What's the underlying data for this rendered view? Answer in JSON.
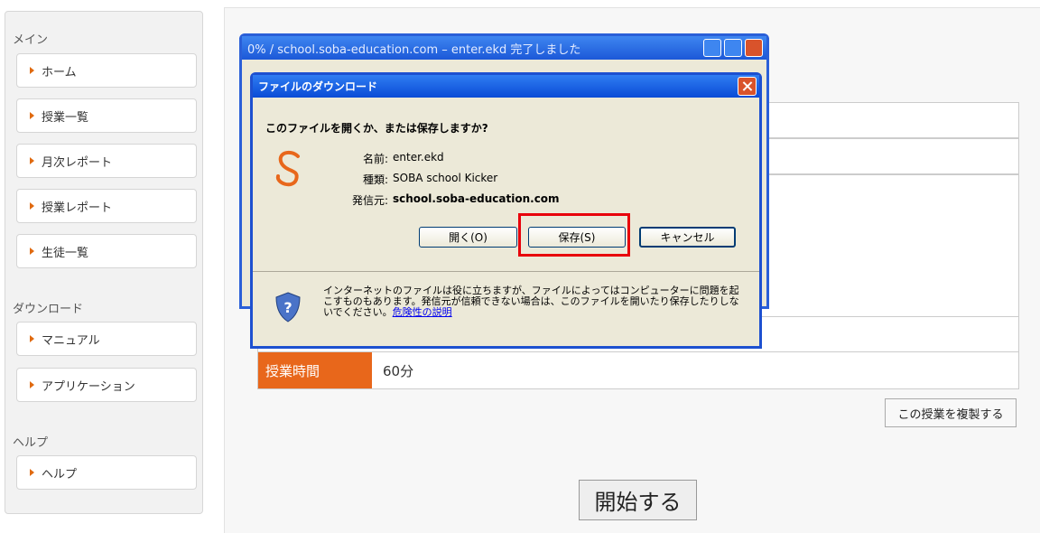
{
  "sidebar": {
    "sections": [
      {
        "heading": "メイン",
        "items": [
          {
            "label": "ホーム"
          },
          {
            "label": "授業一覧"
          },
          {
            "label": "月次レポート"
          },
          {
            "label": "授業レポート"
          },
          {
            "label": "生徒一覧"
          }
        ]
      },
      {
        "heading": "ダウンロード",
        "items": [
          {
            "label": "マニュアル"
          },
          {
            "label": "アプリケーション"
          }
        ]
      },
      {
        "heading": "ヘルプ",
        "items": [
          {
            "label": "ヘルプ"
          }
        ]
      }
    ]
  },
  "main": {
    "rows": [
      {
        "label": "授業時間",
        "value": "60分"
      }
    ],
    "duplicate_button": "この授業を複製する",
    "start_button": "開始する"
  },
  "background_window": {
    "title": "0% / school.soba-education.com – enter.ekd 完了しました"
  },
  "dialog": {
    "title": "ファイルのダウンロード",
    "question": "このファイルを開くか、または保存しますか?",
    "fields": [
      {
        "label": "名前:",
        "value": "enter.ekd"
      },
      {
        "label": "種類:",
        "value": "SOBA school Kicker"
      },
      {
        "label": "発信元:",
        "value": "school.soba-education.com"
      }
    ],
    "buttons": {
      "open": "開く(O)",
      "save": "保存(S)",
      "cancel": "キャンセル"
    },
    "warning": "インターネットのファイルは役に立ちますが、ファイルによってはコンピューターに問題を起こすものもあります。発信元が信頼できない場合は、このファイルを開いたり保存したりしないでください。",
    "warning_link": "危険性の説明"
  },
  "colors": {
    "accent": "#e8671b",
    "highlight": "#e8000b",
    "xp_title": "#0a4bd6"
  }
}
